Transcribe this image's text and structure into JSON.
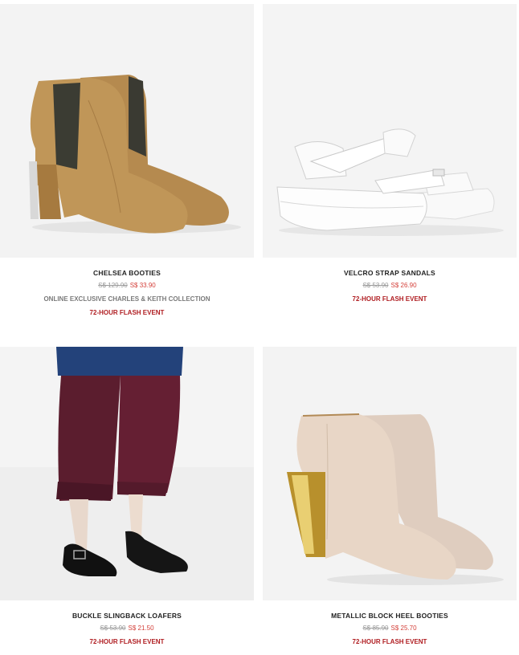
{
  "colors": {
    "sale_price": "#d4403a",
    "flash_event": "#b01e22",
    "exclusive_note": "#7a7a7a",
    "image_bg": "#f2f2f2"
  },
  "products": [
    {
      "name": "CHELSEA BOOTIES",
      "old_price": "S$ 129.90",
      "new_price": "S$ 33.90",
      "note": "ONLINE EXCLUSIVE CHARLES & KEITH COLLECTION",
      "flash": "72-HOUR FLASH EVENT"
    },
    {
      "name": "VELCRO STRAP SANDALS",
      "old_price": "S$ 53.90",
      "new_price": "S$ 26.90",
      "flash": "72-HOUR FLASH EVENT"
    },
    {
      "name": "BUCKLE SLINGBACK LOAFERS",
      "old_price": "S$ 53.90",
      "new_price": "S$ 21.50",
      "flash": "72-HOUR FLASH EVENT"
    },
    {
      "name": "METALLIC BLOCK HEEL BOOTIES",
      "old_price": "S$ 85.90",
      "new_price": "S$ 25.70",
      "flash": "72-HOUR FLASH EVENT"
    }
  ]
}
